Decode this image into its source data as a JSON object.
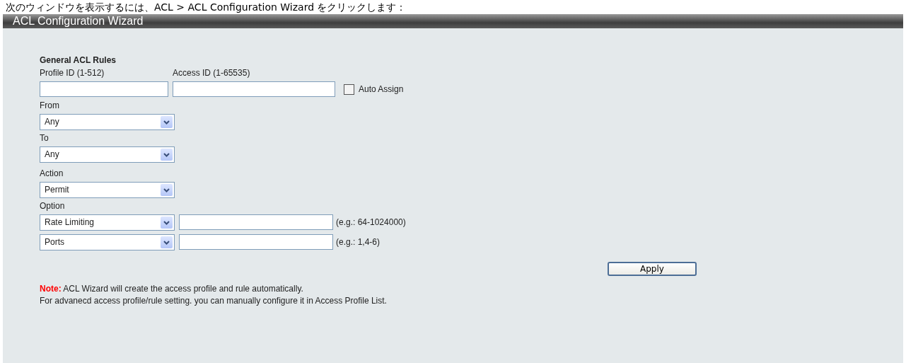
{
  "caption": "次のウィンドウを表示するには、ACL > ACL Configuration Wizard をクリックします：",
  "window": {
    "title": "ACL Configuration Wizard"
  },
  "section": {
    "title": "General ACL Rules"
  },
  "profile_id": {
    "label": "Profile ID (1-512)"
  },
  "access_id": {
    "label": "Access ID (1-65535)"
  },
  "auto_assign": {
    "label": "Auto Assign",
    "checked": false
  },
  "from": {
    "label": "From",
    "value": "Any"
  },
  "to": {
    "label": "To",
    "value": "Any"
  },
  "action": {
    "label": "Action",
    "value": "Permit"
  },
  "option": {
    "label": "Option",
    "rows": [
      {
        "value": "Rate Limiting",
        "hint": "(e.g.: 64-1024000)"
      },
      {
        "value": "Ports",
        "hint": "(e.g.: 1,4-6)"
      }
    ]
  },
  "apply_button": "Apply",
  "note": {
    "label": "Note:",
    "lines": [
      "ACL Wizard will create the access profile and rule automatically.",
      "For advanecd access profile/rule setting. you can manually configure it in Access Profile List."
    ]
  }
}
